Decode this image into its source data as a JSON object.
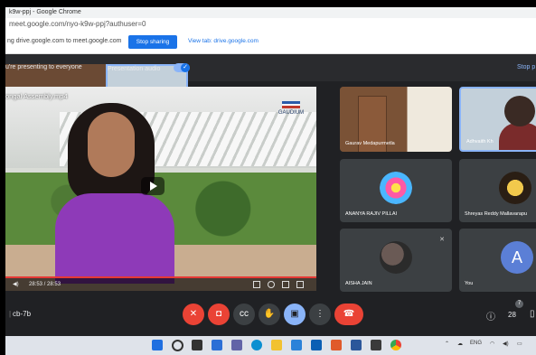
{
  "browser": {
    "title": "k9w-ppj - Google Chrome",
    "url": "meet.google.com/nyo-k9w-ppj?authuser=0"
  },
  "share_bar": {
    "message": "ng drive.google.com to meet.google.com",
    "stop_label": "Stop sharing",
    "view_tab_label": "View tab: drive.google.com"
  },
  "presentation": {
    "status": "u're presenting to everyone",
    "audio_label": "Presentation audio",
    "audio_on": true,
    "stop_label": "Stop p"
  },
  "video": {
    "title": "ongal Assembly.mp4",
    "logo_text": "GAUDIUM",
    "time": "28:53 / 28:53",
    "progress": 1.0
  },
  "participants": [
    {
      "name": "Gaurav Medapurmetla"
    },
    {
      "name": "Adhvaith Kh"
    },
    {
      "name": "ANANYA RAJIV PILLAI"
    },
    {
      "name": "Shreyas Reddy Mallavarapu"
    },
    {
      "name": "AISHA JAIN"
    },
    {
      "name": "You",
      "avatar_letter": "A"
    }
  ],
  "meeting_bar": {
    "code": "cb-7b",
    "participant_count": "28",
    "chat_badge": "7",
    "icons": [
      "mic-off-icon",
      "camera-off-icon",
      "captions-icon",
      "raise-hand-icon",
      "present-icon",
      "more-icon",
      "end-call-icon",
      "info-icon",
      "people-icon",
      "chat-icon"
    ]
  },
  "taskbar": {
    "lang": "ENG",
    "colors": {
      "accent": "#1a73e8",
      "danger": "#ea4335",
      "meet_bg": "#202124"
    }
  }
}
